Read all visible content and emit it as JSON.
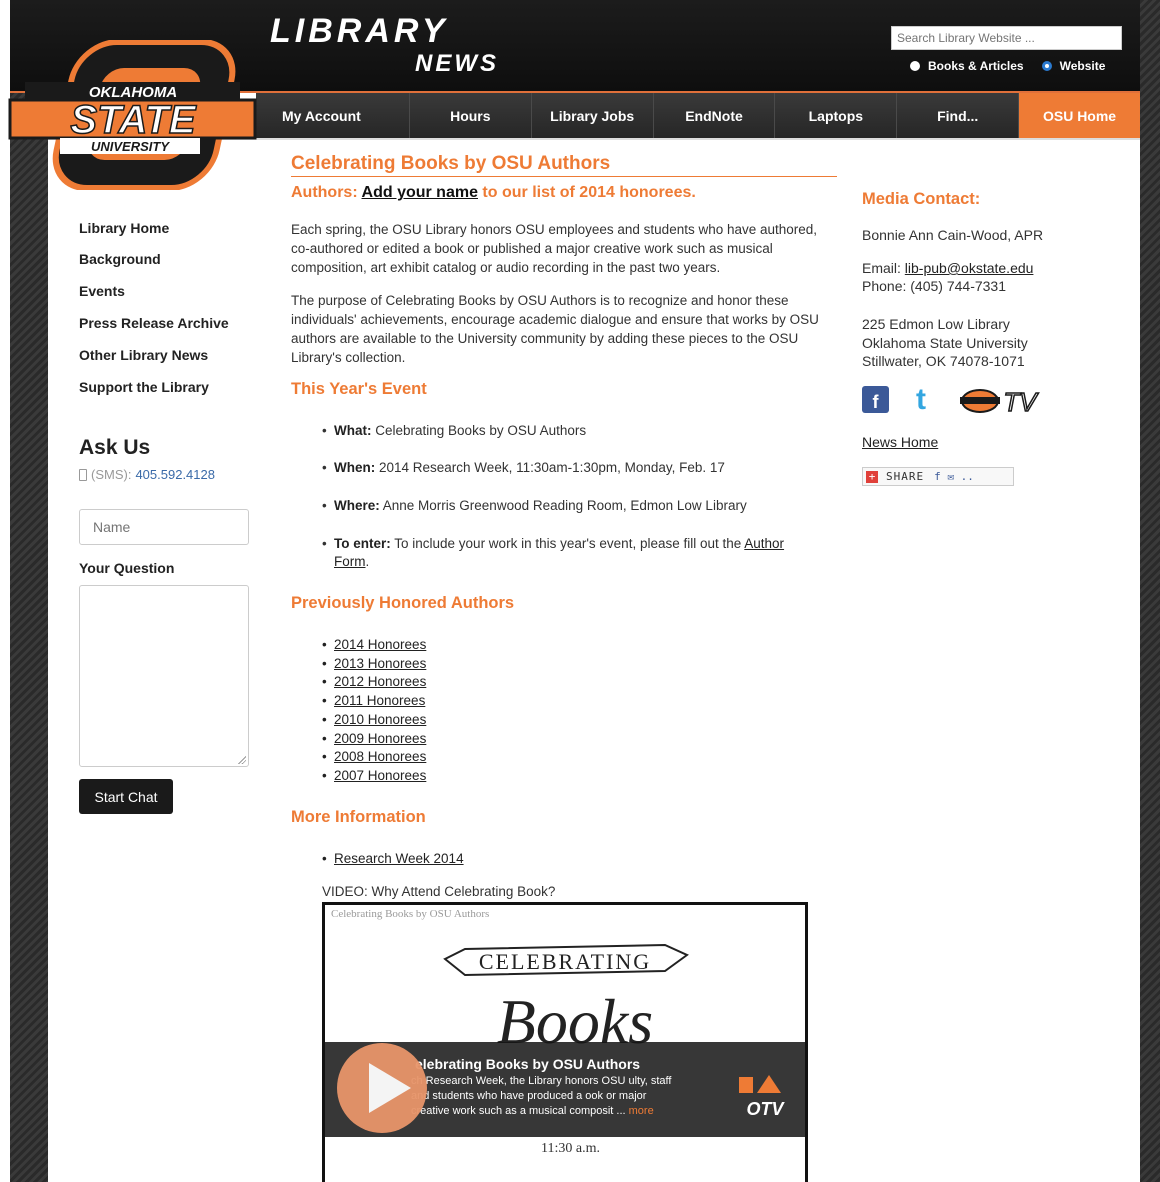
{
  "header": {
    "title": "LIBRARY",
    "subtitle": "NEWS",
    "search_placeholder": "Search Library Website ...",
    "radio_options": [
      "Books & Articles",
      "Website"
    ],
    "radio_selected": "Website"
  },
  "logo": {
    "top_text": "OKLAHOMA",
    "middle_text": "STATE",
    "bottom_text": "UNIVERSITY",
    "colors": {
      "orange": "#ee7b35",
      "black": "#1a1a1a"
    }
  },
  "nav": {
    "items": [
      "My Account",
      "Hours",
      "Library Jobs",
      "EndNote",
      "Laptops",
      "Find...",
      "OSU Home"
    ],
    "active": "OSU Home"
  },
  "sidebar": {
    "links": [
      "Library Home",
      "Background",
      "Events",
      "Press Release Archive",
      "Other Library News",
      "Support the Library"
    ],
    "ask_title": "Ask Us",
    "sms_label": "(SMS):",
    "sms_number": "405.592.4128",
    "name_placeholder": "Name",
    "question_label": "Your Question",
    "chat_button": "Start Chat"
  },
  "main": {
    "title": "Celebrating Books by OSU Authors",
    "sub_prefix": "Authors: ",
    "sub_link": "Add your name",
    "sub_suffix": " to our list of 2014 honorees.",
    "para1": "Each spring, the OSU Library honors OSU employees and students who have authored, co-authored or edited a book or published a major creative work such as musical composition, art exhibit catalog or audio recording in the past two years.",
    "para2": "The purpose of Celebrating Books by OSU Authors is to recognize and honor these individuals' achievements, encourage academic dialogue and ensure that works by OSU authors are available to the University community by adding these pieces to the OSU Library's collection.",
    "event_heading": "This Year's Event",
    "event": {
      "what_label": "What:",
      "what": " Celebrating Books by OSU Authors",
      "when_label": "When:",
      "when": " 2014 Research Week, 11:30am-1:30pm, Monday, Feb. 17",
      "where_label": "Where:",
      "where": " Anne Morris Greenwood Reading Room, Edmon Low Library",
      "enter_label": "To enter:",
      "enter": " To include your work in this year's event, please fill out the ",
      "enter_link1": "Author",
      "enter_link2": "Form",
      "enter_end": "."
    },
    "honored_heading": "Previously Honored Authors",
    "honorees": [
      "2014 Honorees",
      "2013 Honorees",
      "2012 Honorees",
      "2011 Honorees",
      "2010 Honorees",
      "2009 Honorees",
      "2008 Honorees",
      "2007 Honorees"
    ],
    "more_heading": "More Information",
    "more_link": "Research Week 2014",
    "video_caption": "VIDEO: Why Attend Celebrating Book?",
    "video": {
      "top_title": "Celebrating Books by OSU Authors",
      "banner": "CELEBRATING",
      "script_word": "Books",
      "overlay_title": "elebrating Books by OSU Authors",
      "overlay_desc": "ch Research Week, the Library honors OSU ulty, staff and students who have produced a ook or major creative work such as a musical composit ... ",
      "more": "more",
      "time": "11:30 a.m."
    }
  },
  "contact": {
    "heading": "Media Contact:",
    "name": "Bonnie Ann Cain-Wood, APR",
    "email_label": "Email: ",
    "email": "lib-pub@okstate.edu",
    "phone": "Phone: (405) 744-7331",
    "address1": "225 Edmon Low Library",
    "address2": "Oklahoma State University",
    "address3": "Stillwater, OK 74078-1071",
    "news_home": "News Home",
    "share": "SHARE",
    "otv": "OTV"
  }
}
